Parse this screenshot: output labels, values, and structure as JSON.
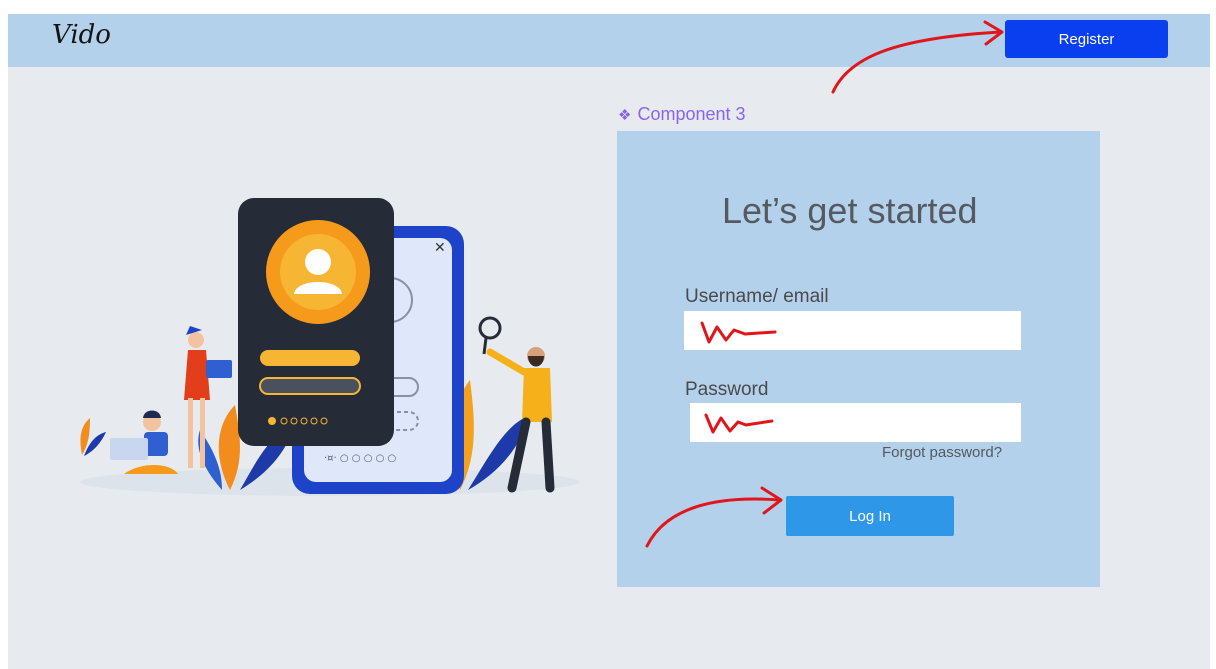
{
  "header": {
    "logo_text": "Vido",
    "register_label": "Register"
  },
  "component_label": "Component 3",
  "login_card": {
    "title": "Let’s get started",
    "username_label": "Username/ email",
    "password_label": "Password",
    "forgot_password": "Forgot password?",
    "login_label": "Log In"
  },
  "colors": {
    "top_bar": "#b4d1ec",
    "card": "#b4d1ec",
    "register_button": "#0a3ff0",
    "login_button": "#2f97e8",
    "component_label": "#8b63ef",
    "annotation": "#e0161b"
  },
  "icons": [
    "component-icon",
    "user-avatar-icon",
    "close-icon",
    "magnifier-icon"
  ]
}
